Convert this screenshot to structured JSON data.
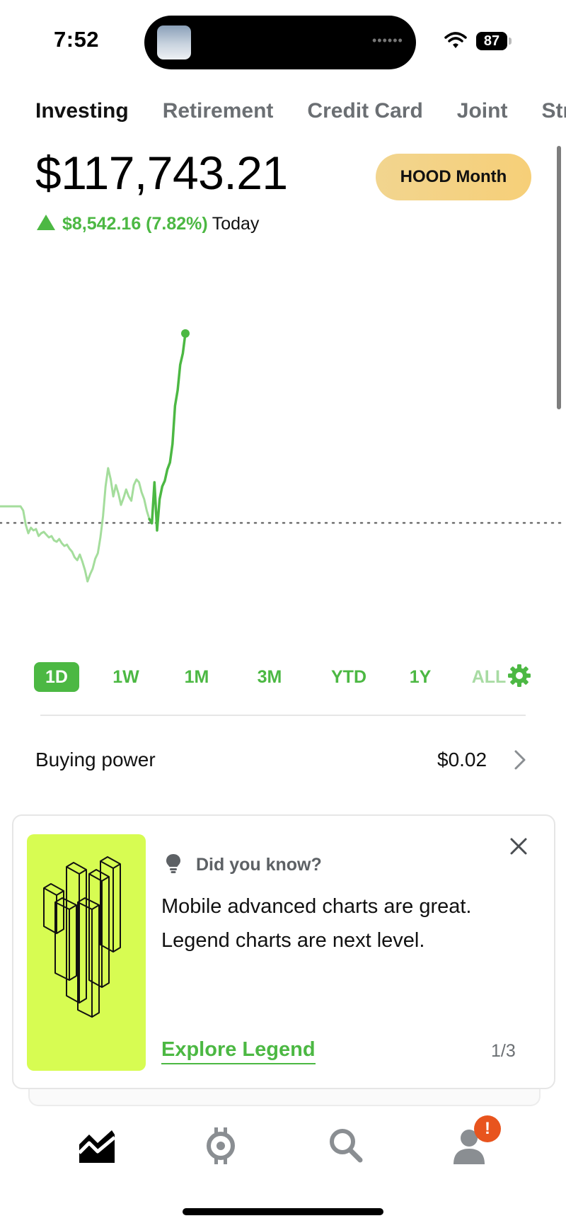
{
  "status_bar": {
    "time": "7:52",
    "battery": "87"
  },
  "tabs": [
    {
      "label": "Investing",
      "active": true
    },
    {
      "label": "Retirement",
      "active": false
    },
    {
      "label": "Credit Card",
      "active": false
    },
    {
      "label": "Joint",
      "active": false
    },
    {
      "label": "Str",
      "active": false
    }
  ],
  "portfolio": {
    "value": "$117,743.21",
    "change": "$8,542.16 (7.82%)",
    "change_period": "Today",
    "promo_label": "HOOD Month"
  },
  "colors": {
    "accent_green": "#4cb843",
    "card_art_lime": "#d7fc52",
    "badge_orange": "#e8541e"
  },
  "chart_data": {
    "type": "line",
    "title": "",
    "xlabel": "",
    "ylabel": "",
    "series": [
      {
        "values": [
          120.0,
          120.0,
          120.0,
          120.0,
          120.0,
          120.0,
          120.0,
          120.0,
          120.0,
          116.7,
          105.6,
          98.9,
          103.3,
          101.1,
          102.2,
          96.7,
          98.9,
          100.0,
          97.8,
          95.6,
          96.7,
          93.3,
          92.2,
          94.4,
          91.1,
          88.9,
          90.0,
          86.7,
          84.4,
          80.0,
          77.8,
          82.2,
          76.7,
          70.0,
          61.1,
          66.7,
          71.1,
          78.9,
          83.3,
          95.6,
          112.2,
          135.6,
          150.0,
          141.1,
          127.8,
          136.7,
          130.0,
          121.1,
          126.7,
          133.3,
          127.8,
          124.4,
          136.7,
          141.1,
          138.9,
          131.1,
          125.6,
          116.7,
          110.0,
          106.7,
          138.9,
          101.1,
          125.6,
          135.6,
          140.0,
          148.9,
          154.4,
          168.9,
          198.9,
          211.1,
          231.1,
          240.0,
          255.6
        ]
      }
    ],
    "reference_line": 107,
    "ylim": [
      60,
      260
    ],
    "grid": false,
    "legend": "none"
  },
  "ranges": [
    {
      "label": "1D",
      "active": true
    },
    {
      "label": "1W",
      "active": false
    },
    {
      "label": "1M",
      "active": false
    },
    {
      "label": "3M",
      "active": false
    },
    {
      "label": "YTD",
      "active": false
    },
    {
      "label": "1Y",
      "active": false
    },
    {
      "label": "ALL",
      "active": false
    }
  ],
  "buying_power": {
    "label": "Buying power",
    "value": "$0.02"
  },
  "card": {
    "kicker": "Did you know?",
    "line1": "Mobile advanced charts are great.",
    "line2": "Legend charts are next level.",
    "link": "Explore Legend",
    "page": "1/3"
  },
  "nav": {
    "items": [
      "investing-icon",
      "crypto-icon",
      "search-icon",
      "account-icon"
    ],
    "badge": "!"
  }
}
